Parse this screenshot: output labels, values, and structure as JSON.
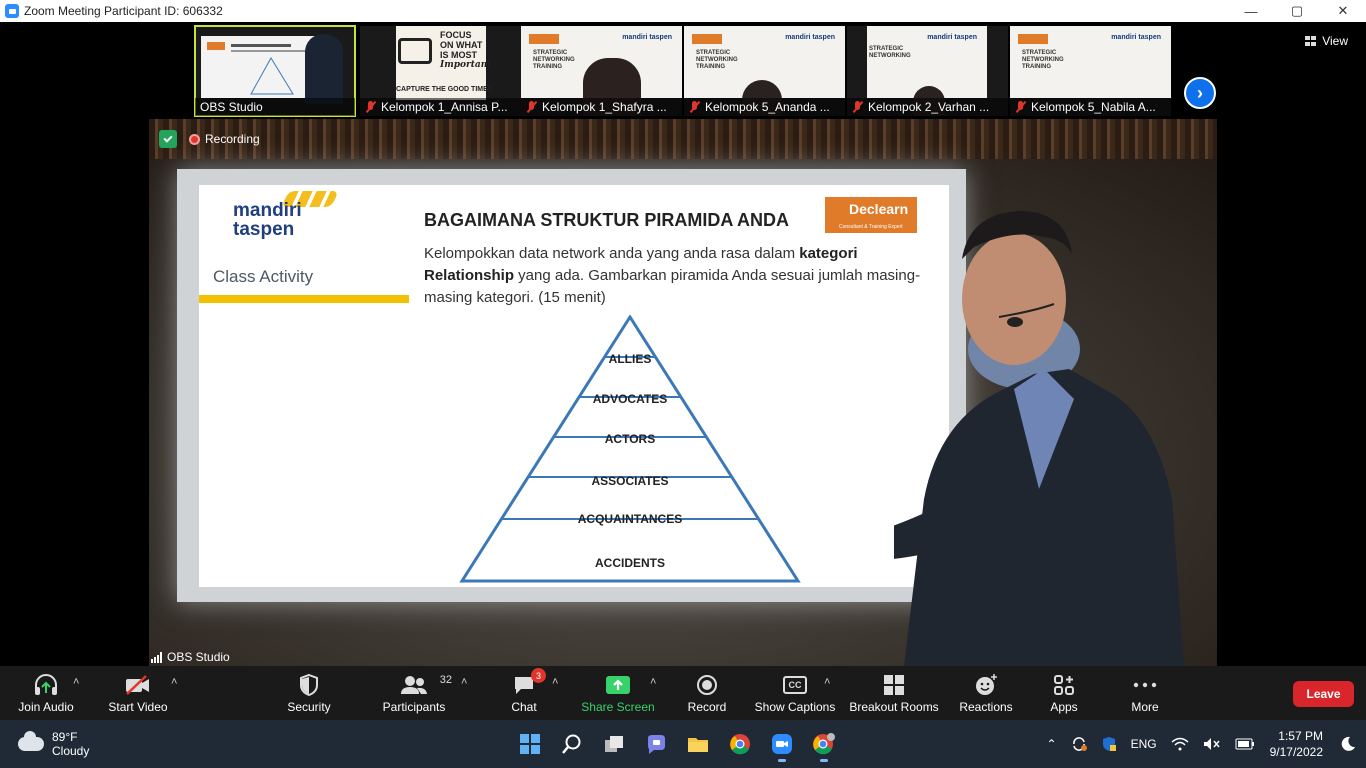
{
  "window": {
    "title": "Zoom Meeting Participant ID: 606332",
    "controls": {
      "minimize": "—",
      "maximize": "▢",
      "close": "✕"
    }
  },
  "top_bar": {
    "view_label": "View"
  },
  "participants_strip": [
    {
      "name": "OBS Studio",
      "muted": false,
      "active": true
    },
    {
      "name": "Kelompok 1_Annisa P...",
      "muted": true
    },
    {
      "name": "Kelompok 1_Shafyra ...",
      "muted": true
    },
    {
      "name": "Kelompok 5_Ananda ...",
      "muted": true
    },
    {
      "name": "Kelompok 2_Varhan ...",
      "muted": true
    },
    {
      "name": "Kelompok 5_Nabila A...",
      "muted": true
    }
  ],
  "thumb_content": {
    "t2_lines": [
      "FOCUS",
      "ON WHAT",
      "IS MOST",
      "Important",
      "CAPTURE THE GOOD TIMES"
    ],
    "slide_title_lines": [
      "STRATEGIC",
      "NETWORKING",
      "TRAINING"
    ],
    "slide_brand": "mandiri taspen",
    "slide_logo": "Dc"
  },
  "main_video": {
    "recording_label": "Recording",
    "speaker_name": "OBS Studio",
    "slide": {
      "logo_line1": "mandiri",
      "logo_line2": "taspen",
      "side_label": "Class Activity",
      "title": "BAGAIMANA STRUKTUR PIRAMIDA ANDA",
      "brand_logo": "Declearn",
      "brand_tagline": "Consultant & Training Expert",
      "body_pre": "Kelompokkan data network anda yang anda rasa dalam ",
      "body_bold1": "kategori Relationship",
      "body_post": " yang ada. Gambarkan piramida Anda sesuai jumlah masing-masing kategori. (15 menit)",
      "pyramid_levels": [
        "ALLIES",
        "ADVOCATES",
        "ACTORS",
        "ASSOCIATES",
        "ACQUAINTANCES",
        "ACCIDENTS"
      ]
    }
  },
  "toolbar": {
    "join_audio": "Join Audio",
    "start_video": "Start Video",
    "security": "Security",
    "participants": "Participants",
    "participants_count": "32",
    "chat": "Chat",
    "chat_badge": "3",
    "share_screen": "Share Screen",
    "record": "Record",
    "show_captions": "Show Captions",
    "cc_icon": "CC",
    "breakout_rooms": "Breakout Rooms",
    "reactions": "Reactions",
    "apps": "Apps",
    "more": "More",
    "leave": "Leave"
  },
  "taskbar": {
    "weather_temp": "89°F",
    "weather_desc": "Cloudy",
    "language": "ENG",
    "time": "1:57 PM",
    "date": "9/17/2022"
  },
  "colors": {
    "leave_red": "#d8262c",
    "share_green": "#37d26a",
    "active_thumb": "#c7e23a",
    "zoom_blue": "#2d8cff"
  }
}
